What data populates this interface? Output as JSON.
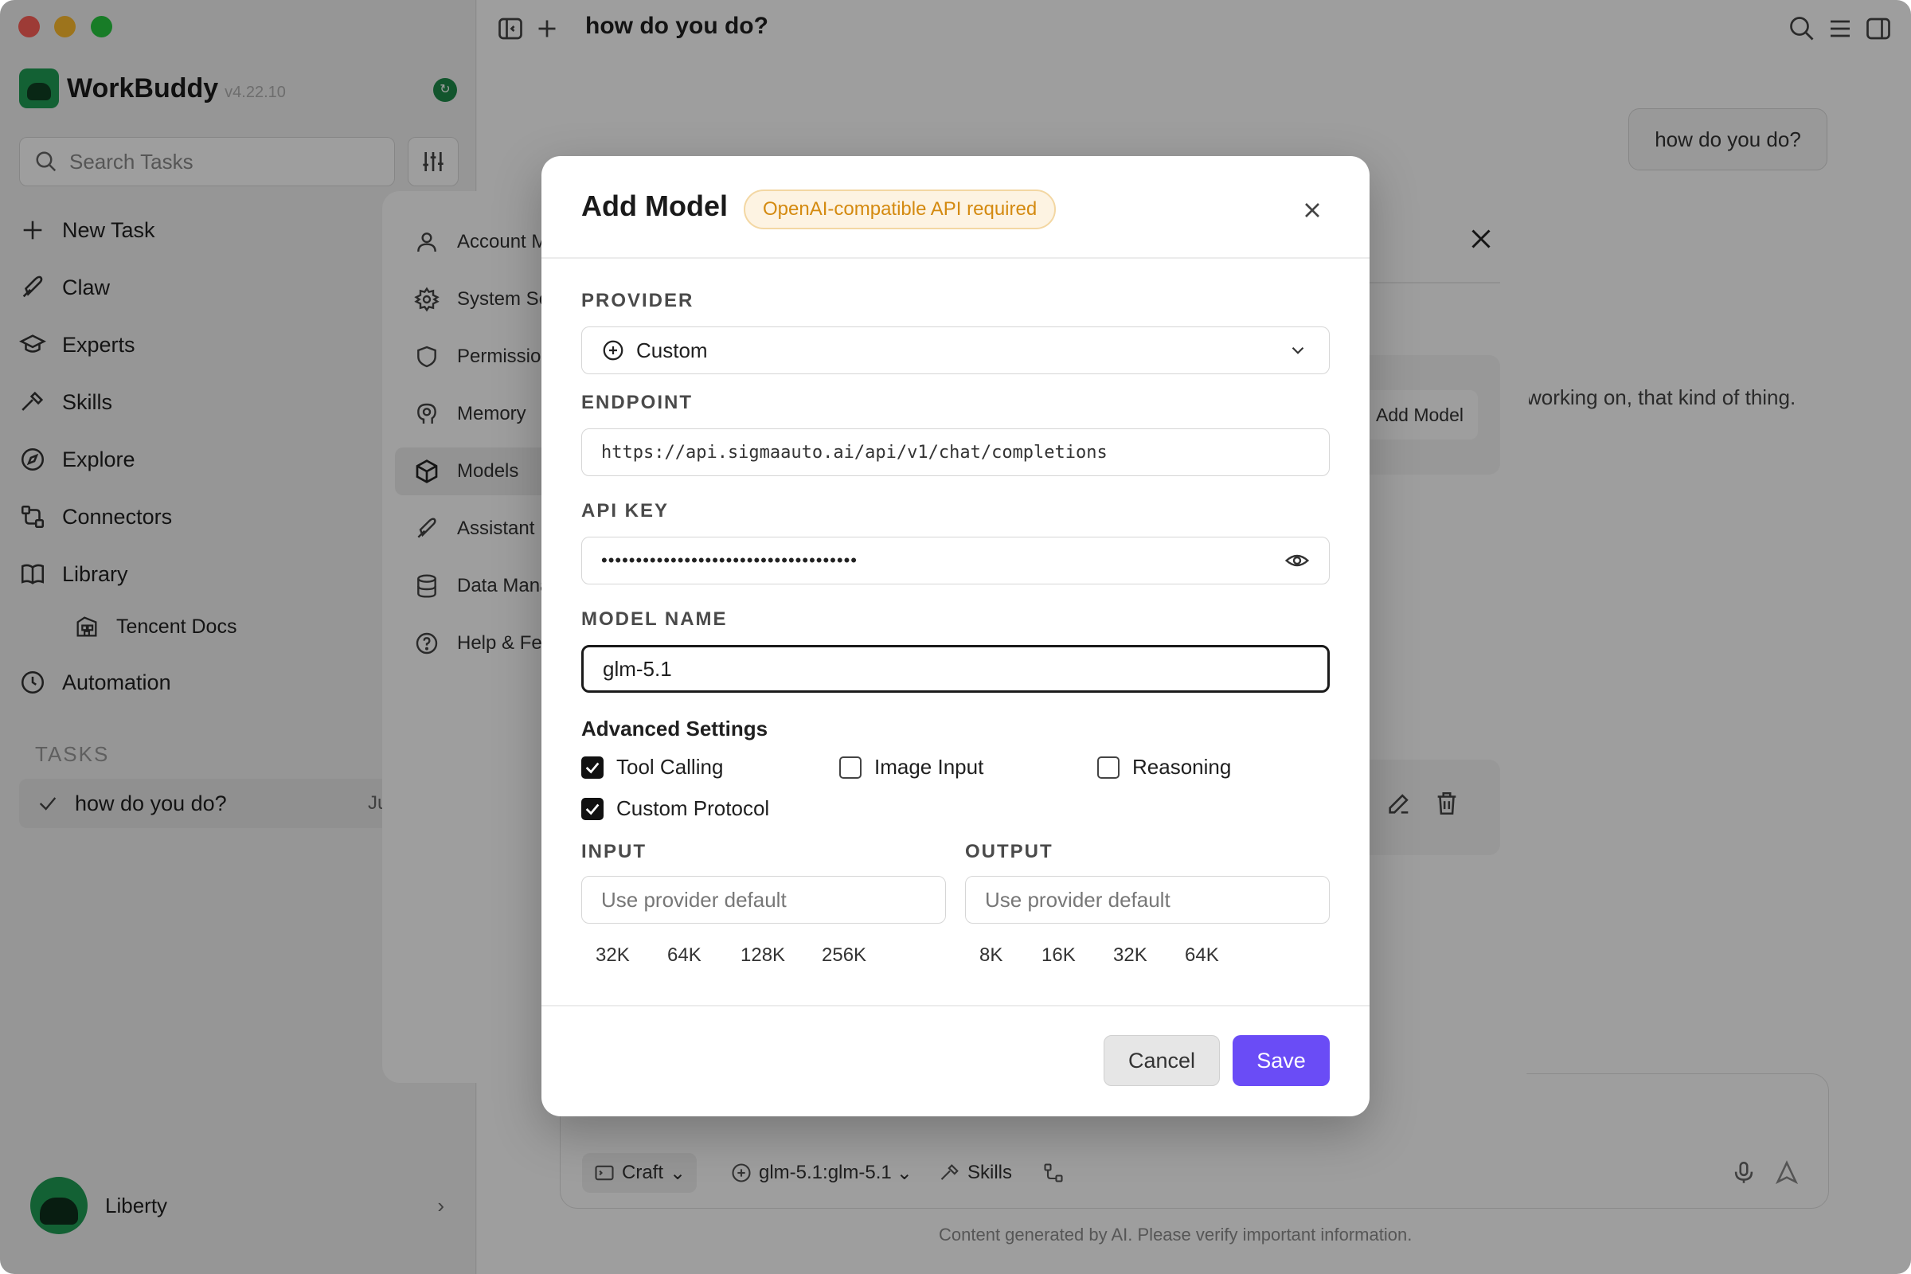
{
  "app": {
    "name": "WorkBuddy",
    "version": "v4.22.10"
  },
  "sidebar": {
    "search_placeholder": "Search Tasks",
    "nav": [
      {
        "label": "New Task",
        "icon": "plus-icon"
      },
      {
        "label": "Claw",
        "icon": "claw-icon"
      },
      {
        "label": "Experts",
        "icon": "graduation-cap-icon"
      },
      {
        "label": "Skills",
        "icon": "hammer-icon"
      },
      {
        "label": "Explore",
        "icon": "compass-icon"
      },
      {
        "label": "Connectors",
        "icon": "connector-icon"
      },
      {
        "label": "Library",
        "icon": "book-icon"
      },
      {
        "label": "Tencent Docs",
        "icon": "docs-icon"
      },
      {
        "label": "Automation",
        "icon": "clock-icon"
      }
    ],
    "tasks_heading": "TASKS",
    "tasks": [
      {
        "label": "how do you do?",
        "suffix": "Ju"
      }
    ],
    "user": {
      "name": "Liberty"
    }
  },
  "main": {
    "conversation_title": "how do you do?",
    "user_message": "how do you do?",
    "reply_fragment": "working on, that kind of thing.",
    "composer": {
      "mode": "Craft",
      "model": "glm-5.1:glm-5.1",
      "skills": "Skills"
    },
    "footer_note": "Content generated by AI. Please verify important information."
  },
  "settings": {
    "menu": [
      {
        "label": "Account M",
        "icon": "user-icon"
      },
      {
        "label": "System Se",
        "icon": "gear-icon"
      },
      {
        "label": "Permissio",
        "icon": "shield-icon"
      },
      {
        "label": "Memory",
        "icon": "brain-icon"
      },
      {
        "label": "Models",
        "icon": "cube-icon",
        "active": true
      },
      {
        "label": "Assistant",
        "icon": "wrench-icon"
      },
      {
        "label": "Data Mana",
        "icon": "database-icon"
      },
      {
        "label": "Help & Fe",
        "icon": "help-icon"
      }
    ],
    "add_model_button": "Add Model"
  },
  "modal": {
    "title": "Add Model",
    "badge": "OpenAI-compatible API required",
    "provider_label": "PROVIDER",
    "provider_value": "Custom",
    "endpoint_label": "ENDPOINT",
    "endpoint_value": "https://api.sigmaauto.ai/api/v1/chat/completions",
    "api_key_label": "API KEY",
    "api_key_masked": "•••••••••••••••••••••••••••••••••••••",
    "model_name_label": "MODEL NAME",
    "model_name_value": "glm-5.1",
    "advanced_title": "Advanced Settings",
    "options": [
      {
        "label": "Tool Calling",
        "checked": true
      },
      {
        "label": "Image Input",
        "checked": false
      },
      {
        "label": "Reasoning",
        "checked": false
      },
      {
        "label": "Custom Protocol",
        "checked": true
      }
    ],
    "input_label": "INPUT",
    "input_placeholder": "Use provider default",
    "input_presets": [
      "32K",
      "64K",
      "128K",
      "256K"
    ],
    "output_label": "OUTPUT",
    "output_placeholder": "Use provider default",
    "output_presets": [
      "8K",
      "16K",
      "32K",
      "64K"
    ],
    "cancel_label": "Cancel",
    "save_label": "Save",
    "accent_color": "#6a4cf6",
    "badge_color": "#d48a10"
  }
}
